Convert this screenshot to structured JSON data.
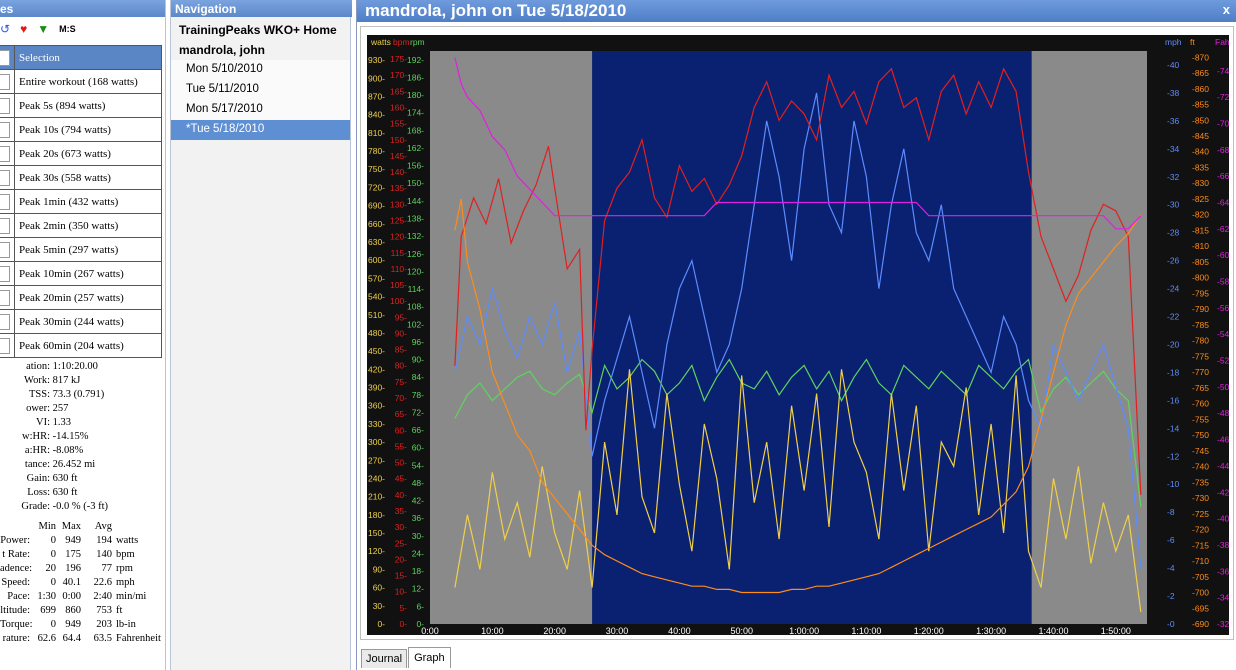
{
  "left_panel": {
    "header": "es",
    "toolbar": {
      "ms_label": "M:S"
    },
    "selection_header": "Selection",
    "peaks": [
      "Entire workout (168 watts)",
      "Peak 5s (894 watts)",
      "Peak 10s (794 watts)",
      "Peak 20s (673 watts)",
      "Peak 30s (558 watts)",
      "Peak 1min (432 watts)",
      "Peak 2min (350 watts)",
      "Peak 5min (297 watts)",
      "Peak 10min (267 watts)",
      "Peak 20min (257 watts)",
      "Peak 30min (244 watts)",
      "Peak 60min (204 watts)"
    ],
    "stats": [
      {
        "label": "ation:",
        "value": "1:10:20.00"
      },
      {
        "label": "Work:",
        "value": "817 kJ"
      },
      {
        "label": "TSS:",
        "value": "73.3 (0.791)"
      },
      {
        "label": "ower:",
        "value": "257"
      },
      {
        "label": "VI:",
        "value": "1.33"
      },
      {
        "label": "w:HR:",
        "value": "-14.15%"
      },
      {
        "label": "a:HR:",
        "value": "-8.08%"
      },
      {
        "label": "tance:",
        "value": "26.452 mi"
      },
      {
        "label": "Gain:",
        "value": "630 ft"
      },
      {
        "label": "Loss:",
        "value": "630 ft"
      },
      {
        "label": "Grade:",
        "value": "-0.0 %  (-3 ft)"
      }
    ],
    "minmax_header": {
      "min": "Min",
      "max": "Max",
      "avg": "Avg"
    },
    "minmax": [
      {
        "label": "Power:",
        "min": "0",
        "max": "949",
        "avg": "194",
        "unit": "watts"
      },
      {
        "label": "t Rate:",
        "min": "0",
        "max": "175",
        "avg": "140",
        "unit": "bpm"
      },
      {
        "label": "adence:",
        "min": "20",
        "max": "196",
        "avg": "77",
        "unit": "rpm"
      },
      {
        "label": "Speed:",
        "min": "0",
        "max": "40.1",
        "avg": "22.6",
        "unit": "mph"
      },
      {
        "label": "Pace:",
        "min": "1:30",
        "max": "0:00",
        "avg": "2:40",
        "unit": "min/mi"
      },
      {
        "label": "ltitude:",
        "min": "699",
        "max": "860",
        "avg": "753",
        "unit": "ft"
      },
      {
        "label": "Torque:",
        "min": "0",
        "max": "949",
        "avg": "203",
        "unit": "lb-in"
      },
      {
        "label": "rature:",
        "min": "62.6",
        "max": "64.4",
        "avg": "63.5",
        "unit": "Fahrenheit"
      }
    ]
  },
  "navigation": {
    "header": "Navigation",
    "home": "TrainingPeaks WKO+ Home",
    "athlete": "mandrola, john",
    "dates": [
      "Mon 5/10/2010",
      "Tue 5/11/2010",
      "Mon 5/17/2010",
      "*Tue 5/18/2010"
    ],
    "selected_index": 3
  },
  "window": {
    "title": "mandrola, john on Tue 5/18/2010",
    "close": "x",
    "tabs": [
      "Journal",
      "Graph"
    ],
    "active_tab": "Graph"
  },
  "colors": {
    "watts": "#f0d04a",
    "bpm": "#e02020",
    "rpm": "#5fd35f",
    "mph": "#5c8cff",
    "ft": "#ff8c1a",
    "fahrenheit": "#e020e0",
    "plot_bg": "#0a2070",
    "unselected_bg": "#8a8a8a",
    "axis_bg": "#111111"
  },
  "chart_data": {
    "type": "line",
    "x_tick_labels": [
      "0:00",
      "10:00",
      "20:00",
      "30:00",
      "40:00",
      "50:00",
      "1:00:00",
      "1:10:00",
      "1:20:00",
      "1:30:00",
      "1:40:00",
      "1:50:00"
    ],
    "x_range_minutes": [
      0,
      115
    ],
    "selection_minutes": [
      26,
      96.5
    ],
    "axes": [
      {
        "name": "watts",
        "unit_label": "watts",
        "range": [
          0,
          945
        ],
        "step": 30,
        "side": "left"
      },
      {
        "name": "bpm",
        "unit_label": "bpm",
        "range": [
          0,
          177.5
        ],
        "step": 5,
        "side": "left"
      },
      {
        "name": "rpm",
        "unit_label": "rpm",
        "range": [
          0,
          195
        ],
        "step": 6,
        "side": "left"
      },
      {
        "name": "mph",
        "unit_label": "mph",
        "range": [
          0,
          41
        ],
        "step": 2,
        "side": "right"
      },
      {
        "name": "ft",
        "unit_label": "ft",
        "range": [
          690,
          872
        ],
        "step": 5,
        "side": "right"
      },
      {
        "name": "fahrenheit",
        "unit_label": "Fahrenheit",
        "range": [
          32,
          75.5
        ],
        "step": 2,
        "side": "right"
      }
    ],
    "series": [
      {
        "name": "watts",
        "axis": "watts",
        "x": [
          4,
          6,
          8,
          10,
          12,
          14,
          16,
          18,
          20,
          22,
          24,
          26,
          28,
          30,
          32,
          34,
          36,
          38,
          40,
          42,
          44,
          46,
          48,
          50,
          52,
          54,
          56,
          58,
          60,
          62,
          64,
          66,
          68,
          70,
          72,
          74,
          76,
          78,
          80,
          82,
          84,
          86,
          88,
          90,
          92,
          94,
          96,
          98,
          100,
          102,
          104,
          106,
          108,
          110,
          112,
          114
        ],
        "values": [
          60,
          180,
          90,
          250,
          140,
          200,
          110,
          260,
          150,
          90,
          220,
          60,
          300,
          180,
          420,
          210,
          150,
          380,
          230,
          120,
          330,
          240,
          90,
          410,
          200,
          300,
          140,
          360,
          220,
          380,
          160,
          420,
          300,
          250,
          140,
          380,
          220,
          360,
          120,
          300,
          260,
          390,
          180,
          330,
          150,
          410,
          120,
          60,
          240,
          140,
          260,
          100,
          200,
          120,
          180,
          20
        ]
      },
      {
        "name": "bpm",
        "axis": "bpm",
        "x": [
          4,
          5,
          7,
          9,
          11,
          13,
          15,
          17,
          19,
          20,
          22,
          24,
          25,
          26,
          28,
          30,
          32,
          34,
          36,
          38,
          40,
          42,
          44,
          46,
          48,
          50,
          52,
          54,
          56,
          58,
          60,
          62,
          64,
          66,
          68,
          70,
          72,
          74,
          76,
          78,
          80,
          82,
          84,
          86,
          88,
          90,
          92,
          94,
          96,
          98,
          100,
          102,
          104,
          106,
          108,
          110,
          112,
          114
        ],
        "values": [
          80,
          120,
          132,
          124,
          138,
          118,
          128,
          136,
          148,
          135,
          110,
          116,
          60,
          85,
          125,
          135,
          140,
          150,
          132,
          126,
          142,
          134,
          138,
          130,
          136,
          145,
          160,
          168,
          156,
          162,
          158,
          150,
          170,
          160,
          165,
          155,
          168,
          172,
          160,
          163,
          150,
          165,
          170,
          158,
          168,
          160,
          172,
          165,
          140,
          120,
          110,
          100,
          108,
          122,
          130,
          128,
          120,
          40
        ]
      },
      {
        "name": "rpm",
        "axis": "rpm",
        "x": [
          4,
          6,
          8,
          10,
          12,
          14,
          16,
          18,
          20,
          22,
          24,
          26,
          28,
          30,
          32,
          34,
          36,
          38,
          40,
          42,
          44,
          46,
          48,
          50,
          52,
          54,
          56,
          58,
          60,
          62,
          64,
          66,
          68,
          70,
          72,
          74,
          76,
          78,
          80,
          82,
          84,
          86,
          88,
          90,
          92,
          94,
          96,
          98,
          100,
          102,
          104,
          106,
          108,
          110,
          112,
          114
        ],
        "values": [
          70,
          78,
          82,
          76,
          80,
          84,
          86,
          80,
          78,
          82,
          85,
          72,
          88,
          80,
          84,
          90,
          86,
          78,
          82,
          88,
          76,
          84,
          90,
          82,
          80,
          86,
          78,
          84,
          88,
          80,
          86,
          76,
          84,
          90,
          82,
          78,
          88,
          84,
          80,
          86,
          82,
          78,
          88,
          84,
          80,
          86,
          90,
          72,
          80,
          84,
          78,
          82,
          86,
          80,
          76,
          40
        ]
      },
      {
        "name": "mph",
        "axis": "mph",
        "x": [
          4,
          6,
          8,
          10,
          12,
          14,
          16,
          18,
          20,
          22,
          24,
          26,
          28,
          30,
          32,
          34,
          36,
          38,
          40,
          42,
          44,
          46,
          48,
          50,
          52,
          54,
          56,
          58,
          60,
          62,
          64,
          66,
          68,
          70,
          72,
          74,
          76,
          78,
          80,
          82,
          84,
          86,
          88,
          90,
          92,
          94,
          96,
          98,
          100,
          102,
          104,
          106,
          108,
          110,
          112,
          114
        ],
        "values": [
          18,
          22,
          20,
          24,
          21,
          19,
          22,
          20,
          23,
          18,
          21,
          12,
          16,
          19,
          22,
          18,
          14,
          20,
          24,
          26,
          22,
          18,
          20,
          24,
          30,
          36,
          32,
          26,
          34,
          38,
          30,
          28,
          36,
          32,
          24,
          30,
          34,
          28,
          26,
          30,
          24,
          22,
          20,
          18,
          22,
          20,
          16,
          14,
          20,
          18,
          16,
          18,
          20,
          17,
          14,
          4
        ]
      },
      {
        "name": "ft",
        "axis": "ft",
        "x": [
          4,
          5,
          6,
          8,
          10,
          12,
          14,
          16,
          18,
          20,
          22,
          24,
          26,
          28,
          30,
          32,
          34,
          36,
          38,
          40,
          42,
          44,
          46,
          48,
          50,
          52,
          54,
          56,
          58,
          60,
          62,
          64,
          66,
          68,
          70,
          72,
          74,
          76,
          78,
          80,
          82,
          84,
          86,
          88,
          90,
          92,
          94,
          96,
          98,
          100,
          102,
          104,
          106,
          108,
          110,
          112,
          114
        ],
        "values": [
          815,
          825,
          805,
          790,
          770,
          760,
          750,
          745,
          735,
          730,
          725,
          720,
          715,
          712,
          710,
          708,
          706,
          705,
          704,
          703,
          702,
          702,
          701,
          701,
          700,
          700,
          700,
          700,
          701,
          701,
          702,
          702,
          703,
          704,
          705,
          706,
          708,
          710,
          712,
          714,
          716,
          718,
          720,
          722,
          724,
          728,
          732,
          740,
          755,
          770,
          785,
          795,
          800,
          805,
          810,
          814,
          820
        ]
      },
      {
        "name": "fahrenheit",
        "axis": "fahrenheit",
        "x": [
          4,
          5,
          6,
          8,
          10,
          12,
          14,
          16,
          18,
          20,
          22,
          24,
          26,
          28,
          30,
          32,
          34,
          36,
          38,
          40,
          42,
          44,
          46,
          48,
          50,
          52,
          54,
          56,
          58,
          60,
          62,
          64,
          66,
          68,
          70,
          72,
          74,
          76,
          78,
          80,
          82,
          84,
          86,
          88,
          90,
          92,
          94,
          96,
          98,
          100,
          102,
          104,
          106,
          108,
          110,
          112,
          114
        ],
        "values": [
          75,
          73,
          72,
          71,
          69,
          68,
          66,
          65,
          64,
          63,
          63,
          63,
          63,
          63,
          63,
          63,
          63,
          63,
          63,
          63,
          63,
          63,
          64,
          64,
          64,
          64,
          64,
          64,
          64,
          64,
          64,
          64,
          64,
          64,
          64,
          64,
          64,
          64,
          64,
          63,
          63,
          63,
          63,
          63,
          63,
          63,
          63,
          63,
          63,
          63,
          63,
          63,
          63,
          63,
          62,
          62,
          63
        ]
      }
    ]
  }
}
